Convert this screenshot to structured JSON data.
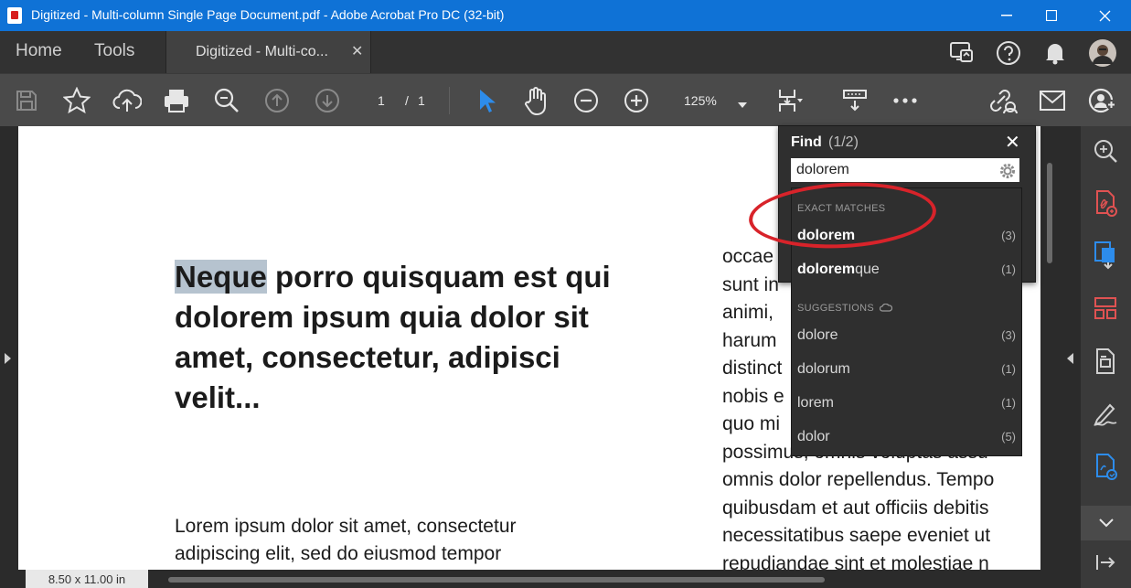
{
  "window": {
    "title": "Digitized - Multi-column Single Page Document.pdf - Adobe Acrobat Pro DC (32-bit)"
  },
  "tabs": {
    "home": "Home",
    "tools": "Tools",
    "document": "Digitized - Multi-co..."
  },
  "toolbar": {
    "page_current": "1",
    "page_sep": "/",
    "page_total": "1",
    "zoom": "125%"
  },
  "document": {
    "heading_highlight": "Neque",
    "heading_rest": " porro quisquam est qui dolorem ipsum quia dolor sit amet, consectetur, adipisci velit...",
    "body_lines": [
      "Lorem ipsum dolor sit amet, consectetur",
      "adipiscing elit, sed do eiusmod tempor"
    ],
    "right_lines": [
      "occae",
      "sunt in",
      "animi,",
      "harum",
      "distinct",
      "nobis e",
      "quo mi",
      "possimus, omnis voluptas assu",
      "omnis dolor repellendus. Tempo",
      "quibusdam et aut officiis debitis",
      "necessitatibus saepe eveniet ut",
      "repudiandae sint et molestiae n"
    ]
  },
  "find": {
    "title": "Find",
    "count": "(1/2)",
    "query": "dolorem",
    "exact_heading": "EXACT MATCHES",
    "exact": [
      {
        "bold": "dolorem",
        "rest": "",
        "count": "(3)"
      },
      {
        "bold": "dolorem",
        "rest": "que",
        "count": "(1)"
      }
    ],
    "suggest_heading": "SUGGESTIONS",
    "suggestions": [
      {
        "term": "dolore",
        "count": "(3)"
      },
      {
        "term": "dolorum",
        "count": "(1)"
      },
      {
        "term": "lorem",
        "count": "(1)"
      },
      {
        "term": "dolor",
        "count": "(5)"
      }
    ]
  },
  "status": {
    "page_size": "8.50 x 11.00 in"
  },
  "colors": {
    "titlebar": "#0f72d6",
    "accent_blue": "#2d8ceb",
    "annotation_red": "#d8232a",
    "tool_red": "#e05252"
  }
}
